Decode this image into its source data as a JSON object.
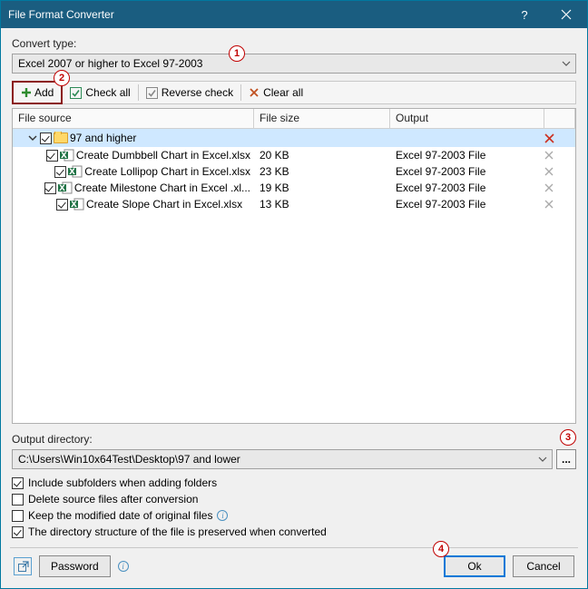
{
  "window": {
    "title": "File Format Converter"
  },
  "labels": {
    "convert_type": "Convert type:",
    "output_directory": "Output directory:"
  },
  "convert_type_value": "Excel 2007 or higher to Excel 97-2003",
  "toolbar": {
    "add": "Add",
    "check_all": "Check all",
    "reverse_check": "Reverse check",
    "clear_all": "Clear all"
  },
  "callouts": {
    "one": "1",
    "two": "2",
    "three": "3",
    "four": "4"
  },
  "columns": {
    "file_source": "File source",
    "file_size": "File size",
    "output": "Output"
  },
  "group": {
    "name": "97 and higher"
  },
  "files": [
    {
      "name": "Create Dumbbell Chart in Excel.xlsx",
      "size": "20 KB",
      "output": "Excel 97-2003 File"
    },
    {
      "name": "Create Lollipop Chart in Excel.xlsx",
      "size": "23 KB",
      "output": "Excel 97-2003 File"
    },
    {
      "name": "Create Milestone Chart in Excel .xl...",
      "size": "19 KB",
      "output": "Excel 97-2003 File"
    },
    {
      "name": "Create Slope Chart in Excel.xlsx",
      "size": "13 KB",
      "output": "Excel 97-2003 File"
    }
  ],
  "output_path": "C:\\Users\\Win10x64Test\\Desktop\\97 and lower",
  "options": {
    "include_subfolders": {
      "label": "Include subfolders when adding folders",
      "checked": true
    },
    "delete_source": {
      "label": "Delete source files after conversion",
      "checked": false
    },
    "keep_date": {
      "label": "Keep the modified date of original files",
      "checked": false
    },
    "preserve_structure": {
      "label": "The directory structure of the file is preserved when converted",
      "checked": true
    }
  },
  "buttons": {
    "password": "Password",
    "ok": "Ok",
    "cancel": "Cancel",
    "browse": "..."
  }
}
